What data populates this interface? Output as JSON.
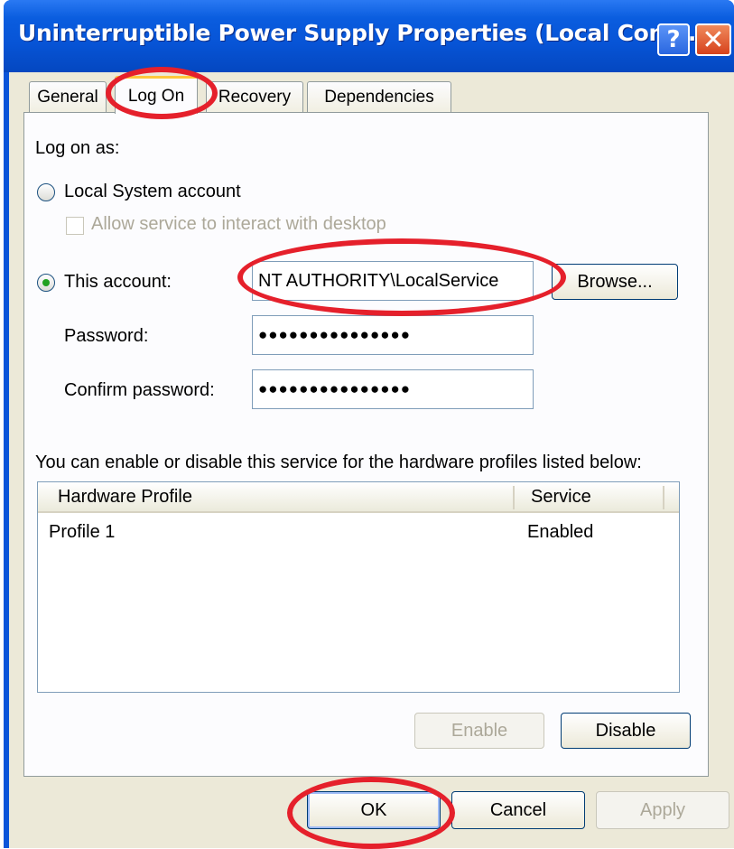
{
  "window": {
    "title": "Uninterruptible Power Supply Properties (Local Comp...",
    "help_glyph": "?",
    "close_glyph": "✕"
  },
  "tabs": [
    {
      "label": "General"
    },
    {
      "label": "Log On"
    },
    {
      "label": "Recovery"
    },
    {
      "label": "Dependencies"
    }
  ],
  "active_tab": "Log On",
  "logon": {
    "log_on_as_label": "Log on as:",
    "local_system_label": "Local System account",
    "allow_interact_label": "Allow service to interact with desktop",
    "this_account_label": "This account:",
    "account_value": "NT AUTHORITY\\LocalService",
    "browse_label": "Browse...",
    "password_label": "Password:",
    "password_value": "●●●●●●●●●●●●●●●",
    "confirm_label": "Confirm password:",
    "confirm_value": "●●●●●●●●●●●●●●●"
  },
  "profiles": {
    "description": "You can enable or disable this service for the hardware profiles listed below:",
    "columns": [
      "Hardware Profile",
      "Service"
    ],
    "rows": [
      {
        "profile": "Profile 1",
        "service": "Enabled"
      }
    ],
    "enable_label": "Enable",
    "disable_label": "Disable"
  },
  "footer": {
    "ok_label": "OK",
    "cancel_label": "Cancel",
    "apply_label": "Apply"
  },
  "annotation_color": "#e5202b"
}
